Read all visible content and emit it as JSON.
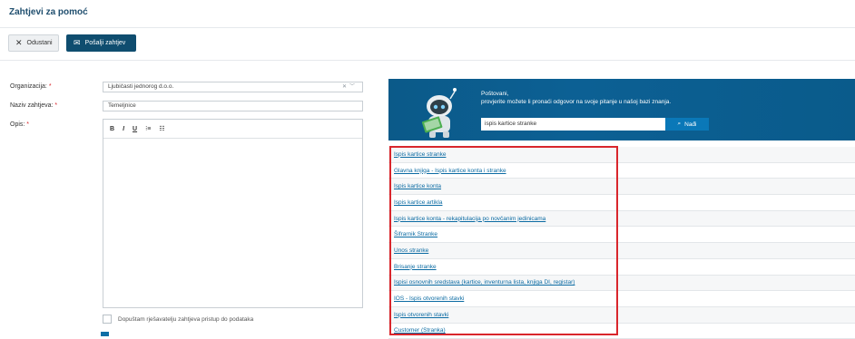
{
  "header": {
    "title": "Zahtjevi za pomoć"
  },
  "toolbar": {
    "cancel_label": "Odustani",
    "send_label": "Pošalji zahtjev"
  },
  "form": {
    "organization_label": "Organizacija:",
    "organization_value": "Ljubičasti jednorog d.o.o.",
    "subject_label": "Naziv zahtjeva:",
    "subject_value": "Temeljnice",
    "description_label": "Opis:",
    "required_mark": "*",
    "editor_buttons": [
      "B",
      "I",
      "U",
      "⁝≡",
      "☷"
    ],
    "access_checkbox_label": "Dopuštam rješavatelju zahtjeva pristup do podataka"
  },
  "knowledge_base": {
    "greeting": "Poštovani,",
    "message": "provjerite možete li pronaći odgovor na svoje pitanje u našoj bazi znanja.",
    "search_value": "ispis kartice stranke",
    "search_button": "Nađi",
    "results": [
      "Ispis kartice stranke",
      "Glavna knjiga - Ispis kartice konta i stranke",
      "Ispis kartice konta",
      "Ispis kartice artikla",
      "Ispis kartice konta - rekapitulacija po novčanim jedinicama",
      "Šifrarnik Stranke",
      "Unos stranke",
      "Brisanje stranke",
      "Ispisi osnovnih sredstava (kartice, inventurna lista, knjiga DI, registar)",
      "IOS - Ispis otvorenih stavki",
      "Ispis otvorenih stavki",
      "Customer (Stranka)"
    ]
  },
  "colors": {
    "brand": "#0f4d6f",
    "banner": "#0b5a89",
    "link": "#0b6ba3",
    "highlight": "#d9262c"
  }
}
